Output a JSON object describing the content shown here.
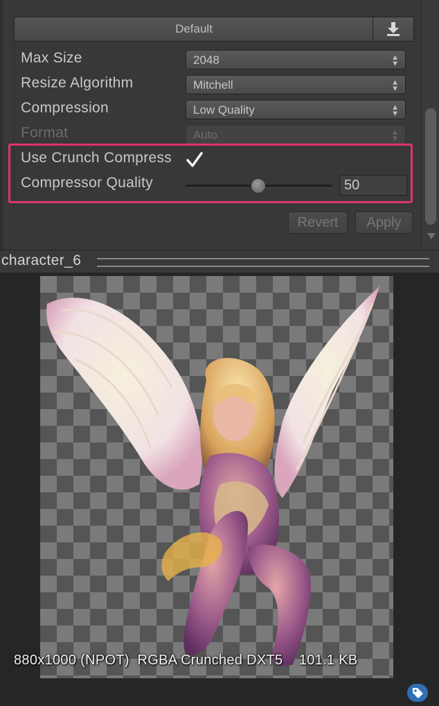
{
  "platform_tab": {
    "label": "Default",
    "download_icon": "download-icon"
  },
  "settings": {
    "max_size": {
      "label": "Max Size",
      "value": "2048"
    },
    "resize_algorithm": {
      "label": "Resize Algorithm",
      "value": "Mitchell"
    },
    "compression": {
      "label": "Compression",
      "value": "Low Quality"
    },
    "format": {
      "label": "Format",
      "value": "Auto"
    },
    "use_crunch": {
      "label": "Use Crunch Compress",
      "checked": true
    },
    "compressor_quality": {
      "label": "Compressor Quality",
      "value": "50",
      "slider_fraction": 0.5
    }
  },
  "buttons": {
    "revert": "Revert",
    "apply": "Apply"
  },
  "preview": {
    "title": "character_6",
    "info": "880x1000 (NPOT)  RGBA Crunched DXT5    101.1 KB",
    "tag_icon": "tag-icon"
  },
  "colors": {
    "highlight": "#e0346b",
    "tag_button": "#2f6fb5"
  }
}
